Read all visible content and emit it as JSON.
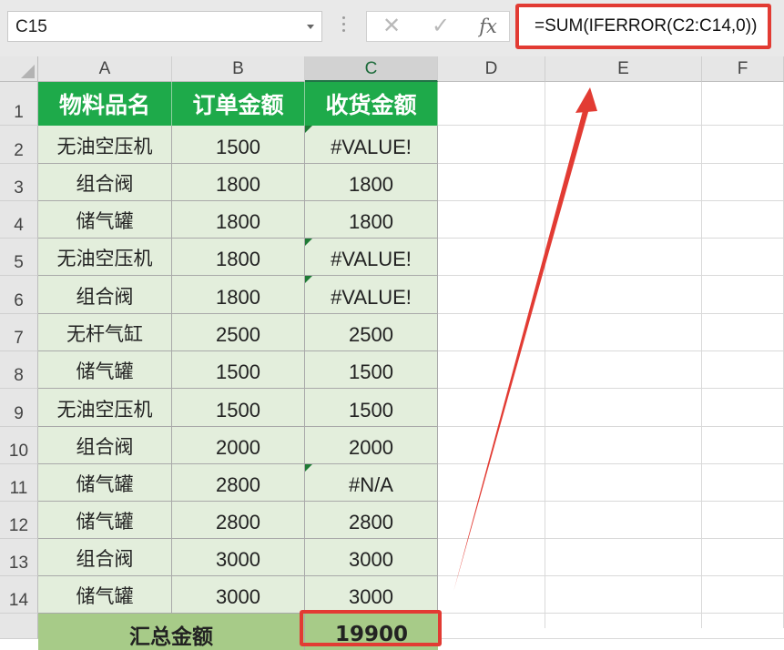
{
  "name_box": "C15",
  "formula_bar": {
    "cancel_icon": "x-icon",
    "enter_icon": "check-icon",
    "fx_label": "fx",
    "formula": "=SUM(IFERROR(C2:C14,0))"
  },
  "columns": [
    "A",
    "B",
    "C",
    "D",
    "E",
    "F"
  ],
  "selected_column": "C",
  "rows": [
    "1",
    "2",
    "3",
    "4",
    "5",
    "6",
    "7",
    "8",
    "9",
    "10",
    "11",
    "12",
    "13",
    "14"
  ],
  "header": [
    "物料品名",
    "订单金额",
    "收货金额"
  ],
  "data": [
    {
      "name": "无油空压机",
      "order": "1500",
      "received": "#VALUE!",
      "error_flag": true
    },
    {
      "name": "组合阀",
      "order": "1800",
      "received": "1800",
      "error_flag": false
    },
    {
      "name": "储气罐",
      "order": "1800",
      "received": "1800",
      "error_flag": false
    },
    {
      "name": "无油空压机",
      "order": "1800",
      "received": "#VALUE!",
      "error_flag": true
    },
    {
      "name": "组合阀",
      "order": "1800",
      "received": "#VALUE!",
      "error_flag": true
    },
    {
      "name": "无杆气缸",
      "order": "2500",
      "received": "2500",
      "error_flag": false
    },
    {
      "name": "储气罐",
      "order": "1500",
      "received": "1500",
      "error_flag": false
    },
    {
      "name": "无油空压机",
      "order": "1500",
      "received": "1500",
      "error_flag": false
    },
    {
      "name": "组合阀",
      "order": "2000",
      "received": "2000",
      "error_flag": false
    },
    {
      "name": "储气罐",
      "order": "2800",
      "received": "#N/A",
      "error_flag": true
    },
    {
      "name": "储气罐",
      "order": "2800",
      "received": "2800",
      "error_flag": false
    },
    {
      "name": "组合阀",
      "order": "3000",
      "received": "3000",
      "error_flag": false
    },
    {
      "name": "储气罐",
      "order": "3000",
      "received": "3000",
      "error_flag": false
    }
  ],
  "total_row": {
    "label": "汇总金额",
    "value": "19900"
  },
  "colors": {
    "header_fill": "#1eaa4a",
    "data_fill": "#e3eedc",
    "total_fill": "#a7cb88",
    "highlight": "#e23b33"
  }
}
